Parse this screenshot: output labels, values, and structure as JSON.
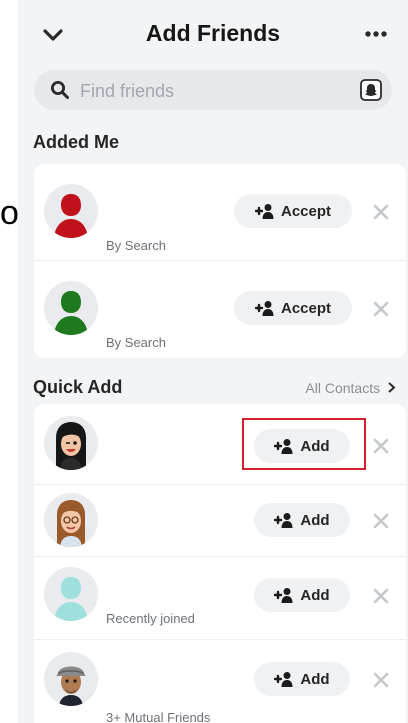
{
  "header": {
    "title": "Add Friends"
  },
  "search": {
    "placeholder": "Find friends"
  },
  "sections": {
    "added_me": "Added Me",
    "quick_add": "Quick Add",
    "all_contacts": "All Contacts"
  },
  "added_me": [
    {
      "subtitle": "By Search",
      "action": "Accept",
      "avatar_color": "#c1121b"
    },
    {
      "subtitle": "By Search",
      "action": "Accept",
      "avatar_color": "#1f7a1f"
    }
  ],
  "quick_add": [
    {
      "subtitle": "",
      "action": "Add",
      "avatar": "bitmoji-dark-hair-winking"
    },
    {
      "subtitle": "",
      "action": "Add",
      "avatar": "bitmoji-brown-hair-glasses"
    },
    {
      "subtitle": "Recently joined",
      "action": "Add",
      "avatar_color": "#9fe0dc"
    },
    {
      "subtitle": "3+ Mutual Friends",
      "action": "Add",
      "avatar": "bitmoji-cap"
    }
  ],
  "stray_text": "o",
  "colors": {
    "highlight": "#d2202a",
    "background": "#f3f4f6"
  }
}
